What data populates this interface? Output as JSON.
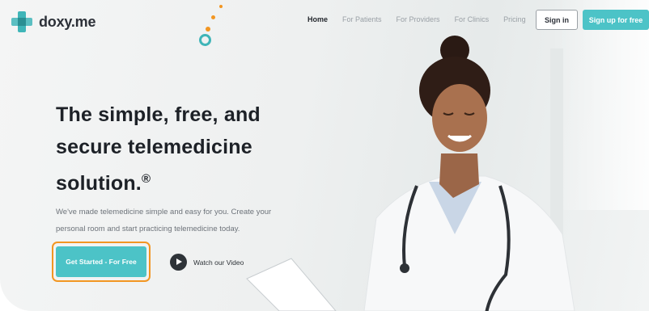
{
  "brand": {
    "name": "doxy.me"
  },
  "nav": {
    "items": [
      {
        "label": "Home",
        "active": true
      },
      {
        "label": "For Patients",
        "active": false
      },
      {
        "label": "For Providers",
        "active": false
      },
      {
        "label": "For Clinics",
        "active": false
      },
      {
        "label": "Pricing",
        "active": false
      }
    ],
    "sign_in": "Sign in",
    "sign_up": "Sign up for free"
  },
  "hero": {
    "headline_lines": [
      "The simple, free, and",
      "secure telemedicine",
      "solution."
    ],
    "headline_mark": "®",
    "subtext_lines": [
      "We've made telemedicine simple and easy for you. Create your",
      "personal room and start practicing telemedicine today."
    ],
    "cta_label": "Get Started - For Free",
    "video_label": "Watch our Video"
  },
  "colors": {
    "accent": "#4cc3c7",
    "brand": "#3fb5b8",
    "focus_ring": "#f29622",
    "text_dark": "#1d2127"
  },
  "icons": {
    "logo": "doxy-cross-logo-icon",
    "play": "play-circle-icon"
  }
}
